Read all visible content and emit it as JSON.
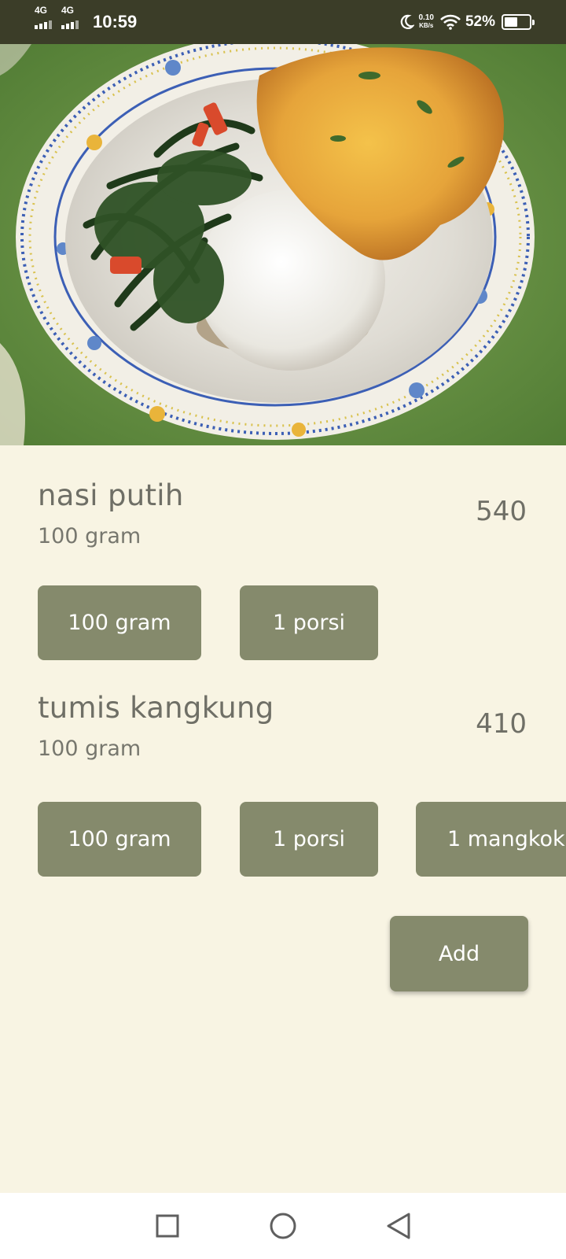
{
  "status_bar": {
    "network_1": "4G",
    "network_2": "4G",
    "time": "10:59",
    "speed_value": "0.10",
    "speed_unit": "KB/s",
    "battery": "52%",
    "battery_level": 0.52
  },
  "hero": {
    "icon": "food-photo"
  },
  "foods": [
    {
      "name": "nasi putih",
      "quantity": "100 gram",
      "calories": "540",
      "options": [
        "100 gram",
        "1 porsi"
      ]
    },
    {
      "name": "tumis kangkung",
      "quantity": "100 gram",
      "calories": "410",
      "options": [
        "100 gram",
        "1 porsi",
        "1 mangkok"
      ]
    }
  ],
  "actions": {
    "add_label": "Add"
  },
  "nav": {
    "recents_icon": "square-icon",
    "home_icon": "circle-icon",
    "back_icon": "triangle-back-icon"
  },
  "colors": {
    "status_bar_bg": "#3b3d28",
    "page_bg": "#f8f4e3",
    "button_bg": "#858a6c",
    "text_primary": "#6f6f66"
  }
}
